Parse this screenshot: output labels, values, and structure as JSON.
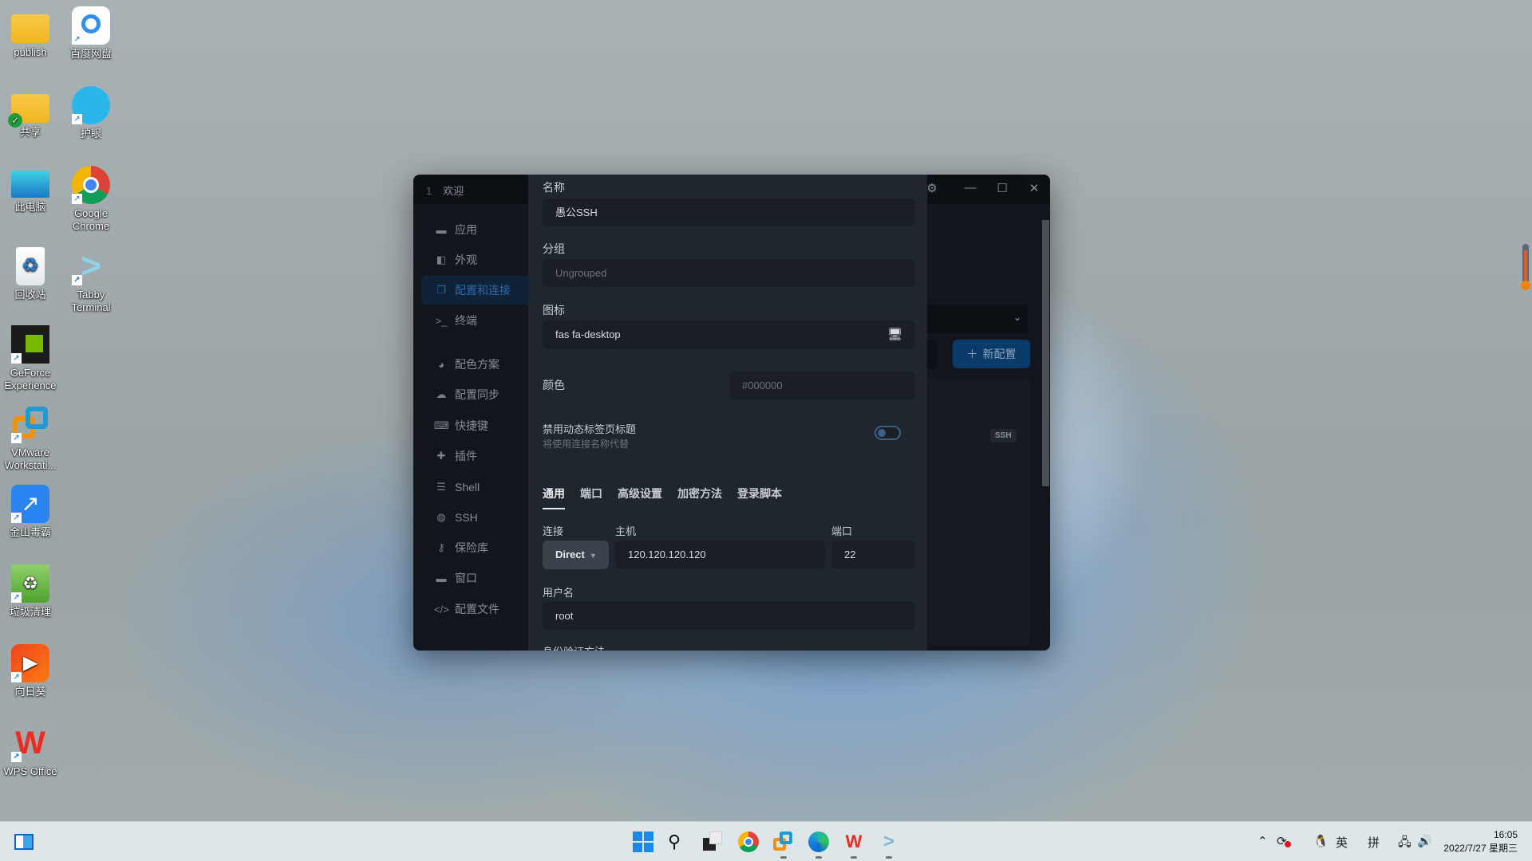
{
  "desktop": {
    "icons": [
      {
        "label": "publish",
        "icon": "folder-icon"
      },
      {
        "label": "百度网盘",
        "icon": "baidu-netdisk-icon"
      },
      {
        "label": "共享",
        "icon": "shared-folder-icon"
      },
      {
        "label": "护眼",
        "icon": "eye-care-icon"
      },
      {
        "label": "此电脑",
        "icon": "this-pc-icon"
      },
      {
        "label": "Google Chrome",
        "icon": "chrome-icon"
      },
      {
        "label": "回收站",
        "icon": "recycle-bin-icon"
      },
      {
        "label": "Tabby Terminal",
        "icon": "tabby-icon"
      },
      {
        "label": "GeForce Experience",
        "icon": "geforce-icon"
      },
      {
        "label": "VMware Workstati...",
        "icon": "vmware-icon"
      },
      {
        "label": "金山毒霸",
        "icon": "kingsoft-antivirus-icon"
      },
      {
        "label": "垃圾清理",
        "icon": "junk-cleaner-icon"
      },
      {
        "label": "向日葵",
        "icon": "sunflower-icon"
      },
      {
        "label": "WPS Office",
        "icon": "wps-icon"
      }
    ]
  },
  "window": {
    "tab_index": "1",
    "tab_title": "欢迎",
    "sidebar": [
      {
        "label": "应用",
        "icon": "window-icon"
      },
      {
        "label": "外观",
        "icon": "palette-swatch-icon"
      },
      {
        "label": "配置和连接",
        "icon": "profiles-icon",
        "active": true
      },
      {
        "label": "终端",
        "icon": "terminal-icon"
      },
      {
        "label": "配色方案",
        "icon": "color-palette-icon"
      },
      {
        "label": "配置同步",
        "icon": "cloud-icon"
      },
      {
        "label": "快捷键",
        "icon": "keyboard-icon"
      },
      {
        "label": "插件",
        "icon": "puzzle-icon"
      },
      {
        "label": "Shell",
        "icon": "list-icon"
      },
      {
        "label": "SSH",
        "icon": "globe-icon"
      },
      {
        "label": "保险库",
        "icon": "key-icon"
      },
      {
        "label": "窗口",
        "icon": "window-icon"
      },
      {
        "label": "配置文件",
        "icon": "code-icon"
      }
    ],
    "right": {
      "new_profile": "新配置",
      "badge": "SSH"
    }
  },
  "form": {
    "name_label": "名称",
    "name_value": "愚公SSH",
    "group_label": "分组",
    "group_placeholder": "Ungrouped",
    "icon_label": "图标",
    "icon_value": "fas fa-desktop",
    "color_label": "颜色",
    "color_placeholder": "#000000",
    "dynamic_title_label": "禁用动态标签页标题",
    "dynamic_title_hint": "将使用连接名称代替",
    "dynamic_title_enabled": false,
    "tabs": [
      {
        "label": "通用",
        "active": true
      },
      {
        "label": "端口"
      },
      {
        "label": "高级设置"
      },
      {
        "label": "加密方法"
      },
      {
        "label": "登录脚本"
      }
    ],
    "conn_label": "连接",
    "conn_value": "Direct",
    "host_label": "主机",
    "host_value": "120.120.120.120",
    "port_label": "端口",
    "port_value": "22",
    "user_label": "用户名",
    "user_value": "root",
    "auth_label": "身份验证方法"
  },
  "taskbar": {
    "apps": [
      "start-icon",
      "search-icon",
      "task-view-icon",
      "chrome-icon",
      "vmware-icon",
      "edge-icon",
      "wps-icon",
      "tabby-icon"
    ],
    "ime_lang": "英",
    "ime_mode": "拼",
    "time": "16:05",
    "date": "2022/7/27 星期三"
  }
}
